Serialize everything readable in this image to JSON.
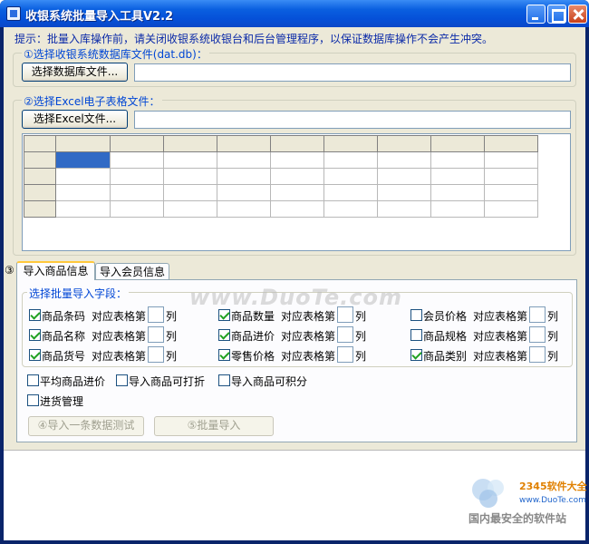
{
  "window": {
    "title": "收银系统批量导入工具V2.2"
  },
  "hint": "提示：批量入库操作前，请关闭收银系统收银台和后台管理程序，以保证数据库操作不会产生冲突。",
  "step1": {
    "title": "①选择收银系统数据库文件(dat.db)：",
    "button": "选择数据库文件...",
    "path_value": ""
  },
  "step2": {
    "title": "②选择Excel电子表格文件：",
    "button": "选择Excel文件...",
    "path_value": ""
  },
  "step3_marker": "③",
  "tabs": [
    {
      "label": "导入商品信息",
      "selected": true
    },
    {
      "label": "导入会员信息",
      "selected": false
    }
  ],
  "fields_group": {
    "title": "选择批量导入字段：",
    "map_prefix": "对应表格第",
    "map_suffix": "列",
    "fields": [
      {
        "label": "商品条码",
        "checked": true,
        "column": ""
      },
      {
        "label": "商品名称",
        "checked": true,
        "column": ""
      },
      {
        "label": "商品货号",
        "checked": true,
        "column": ""
      },
      {
        "label": "商品数量",
        "checked": true,
        "column": ""
      },
      {
        "label": "商品进价",
        "checked": true,
        "column": ""
      },
      {
        "label": "零售价格",
        "checked": true,
        "column": ""
      },
      {
        "label": "会员价格",
        "checked": false,
        "column": ""
      },
      {
        "label": "商品规格",
        "checked": false,
        "column": ""
      },
      {
        "label": "商品类别",
        "checked": true,
        "column": ""
      }
    ]
  },
  "options": [
    {
      "label": "平均商品进价",
      "checked": false
    },
    {
      "label": "导入商品可打折",
      "checked": false
    },
    {
      "label": "导入商品可积分",
      "checked": false
    },
    {
      "label": "进货管理",
      "checked": false
    }
  ],
  "actions": {
    "test_button": "④导入一条数据测试",
    "batch_button": "⑤批量导入"
  },
  "watermark": {
    "text": "www.DuoTe.com",
    "brand": "2345软件大全",
    "site": "www.DuoTe.com",
    "slogan": "国内最安全的软件站"
  },
  "colors": {
    "titlebar": "#0a5fe0",
    "hint_text": "#0b2aa8",
    "group_title": "#0046d5",
    "selection": "#316ac5",
    "check": "#21a121"
  }
}
